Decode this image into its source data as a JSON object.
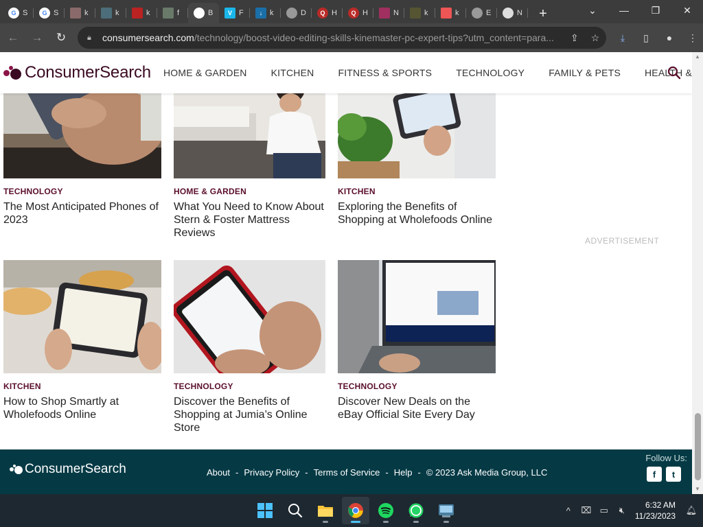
{
  "browser": {
    "tabs": [
      {
        "label": "S",
        "icon": "google-icon",
        "color": "#4285f4",
        "glyph": "G"
      },
      {
        "label": "S",
        "icon": "google-icon",
        "color": "#4285f4",
        "glyph": "G"
      },
      {
        "label": "k",
        "icon": "thumbnail-icon",
        "color": "#8a6a6a",
        "glyph": ""
      },
      {
        "label": "k",
        "icon": "thumbnail-icon",
        "color": "#4b6e7a",
        "glyph": ""
      },
      {
        "label": "k",
        "icon": "thumbnail-icon",
        "color": "#b22",
        "glyph": ""
      },
      {
        "label": "f",
        "icon": "thumbnail-icon",
        "color": "#6a7a6a",
        "glyph": ""
      },
      {
        "label": "B",
        "icon": "page-icon",
        "color": "#ffffff",
        "glyph": "",
        "active": true
      },
      {
        "label": "F",
        "icon": "vimeo-icon",
        "color": "#1ab7ea",
        "glyph": "V"
      },
      {
        "label": "k",
        "icon": "download-site-icon",
        "color": "#1a6fa8",
        "glyph": "↓"
      },
      {
        "label": "D",
        "icon": "globe-icon",
        "color": "#999",
        "glyph": ""
      },
      {
        "label": "H",
        "icon": "quora-icon",
        "color": "#b92b27",
        "glyph": "Q"
      },
      {
        "label": "H",
        "icon": "quora-icon",
        "color": "#b92b27",
        "glyph": "Q"
      },
      {
        "label": "N",
        "icon": "thumbnail-icon",
        "color": "#a03060",
        "glyph": ""
      },
      {
        "label": "k",
        "icon": "thumbnail-icon",
        "color": "#553",
        "glyph": ""
      },
      {
        "label": "k",
        "icon": "thumbnail-icon",
        "color": "#e55",
        "glyph": ""
      },
      {
        "label": "E",
        "icon": "globe-icon",
        "color": "#999",
        "glyph": ""
      },
      {
        "label": "N",
        "icon": "chrome-icon",
        "color": "#ddd",
        "glyph": ""
      }
    ],
    "url_host": "consumersearch.com",
    "url_path": "/technology/boost-video-editing-skills-kinemaster-pc-expert-tips?utm_content=para..."
  },
  "site": {
    "logo_text": "ConsumerSearch",
    "nav": [
      "HOME & GARDEN",
      "KITCHEN",
      "FITNESS & SPORTS",
      "TECHNOLOGY",
      "FAMILY & PETS",
      "HEALTH & BEAUTY"
    ],
    "ad_label": "ADVERTISEMENT"
  },
  "cards": [
    {
      "category": "TECHNOLOGY",
      "title": "The Most Anticipated Phones of 2023"
    },
    {
      "category": "HOME & GARDEN",
      "title": "What You Need to Know About Stern & Foster Mattress Reviews"
    },
    {
      "category": "KITCHEN",
      "title": "Exploring the Benefits of Shopping at Wholefoods Online"
    },
    {
      "category": "KITCHEN",
      "title": "How to Shop Smartly at Wholefoods Online"
    },
    {
      "category": "TECHNOLOGY",
      "title": "Discover the Benefits of Shopping at Jumia’s Online Store"
    },
    {
      "category": "TECHNOLOGY",
      "title": "Discover New Deals on the eBay Official Site Every Day"
    }
  ],
  "footer": {
    "logo_text": "ConsumerSearch",
    "links": [
      "About",
      "Privacy Policy",
      "Terms of Service",
      "Help"
    ],
    "separator": "-",
    "copyright": "© 2023 Ask Media Group, LLC",
    "follow": "Follow Us:",
    "facebook": "f",
    "twitter": "t"
  },
  "taskbar": {
    "time": "6:32 AM",
    "date": "11/23/2023"
  },
  "colors": {
    "brand": "#5a0f2c",
    "footer_bg": "#053a45",
    "logo_dot_1": "#8a1448",
    "logo_dot_2": "#3a0a22"
  }
}
